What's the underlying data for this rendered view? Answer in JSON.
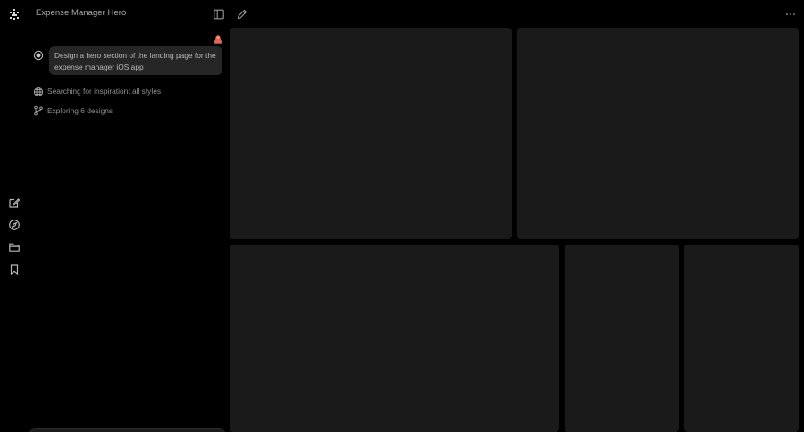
{
  "header": {
    "title": "Expense Manager Hero"
  },
  "icons": {
    "logo": "app-logo-icon",
    "new_chat": "edit-icon",
    "explore": "compass-icon",
    "projects": "folder-icon",
    "saved": "bookmark-icon",
    "toggle_sidebar": "sidebar-toggle-icon",
    "compose": "pencil-icon",
    "more": "ellipsis-icon"
  },
  "chat": {
    "prompt": "Design a hero section of the landing page for the expense manager iOS app",
    "steps": [
      {
        "icon": "globe-icon",
        "text": "Searching for inspiration: all styles"
      },
      {
        "icon": "branch-icon",
        "text": "Exploring 6 designs"
      }
    ]
  },
  "colors": {
    "background": "#000000",
    "tile": "#1a1a1a",
    "bubble": "#262626",
    "avatar": "#d9685c"
  }
}
